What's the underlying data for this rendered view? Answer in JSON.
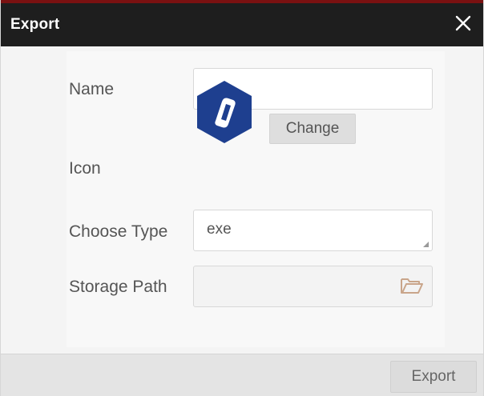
{
  "dialog": {
    "title": "Export",
    "close_icon": "close-icon"
  },
  "form": {
    "name_label": "Name",
    "name_value": "",
    "icon_label": "Icon",
    "app_icon": "hexagon-app-icon",
    "change_label": "Change",
    "type_label": "Choose Type",
    "type_value": "exe",
    "path_label": "Storage Path",
    "path_value": "",
    "folder_icon": "folder-open-icon"
  },
  "footer": {
    "export_label": "Export"
  },
  "colors": {
    "title_bar": "#1e1e1e",
    "top_accent": "#7a1111",
    "app_icon_blue": "#1e3f8f",
    "folder_icon": "#c9a58a"
  }
}
